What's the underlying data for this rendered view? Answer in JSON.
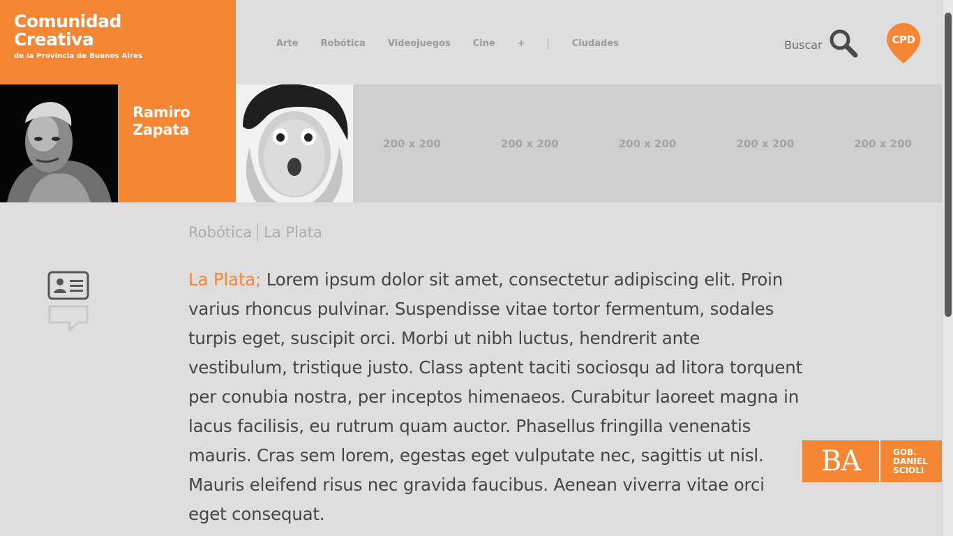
{
  "header": {
    "logo": {
      "line1": "Comunidad",
      "line2": "Creativa",
      "sub": "de la Provincia de Buenos Aires"
    },
    "nav": [
      "Arte",
      "Robótica",
      "Videojuegos",
      "Cine",
      "+",
      "Ciudades"
    ],
    "search_label": "Buscar",
    "cpd_label": "CPD"
  },
  "gallery": {
    "person_name_line1": "Ramiro",
    "person_name_line2": "Zapata",
    "placeholders": [
      "200 x 200",
      "200 x 200",
      "200 x 200",
      "200 x 200",
      "200 x 200"
    ]
  },
  "content": {
    "breadcrumb": {
      "category": "Robótica",
      "city": "La Plata"
    },
    "article": {
      "lead": "La Plata;",
      "body": " Lorem ipsum dolor sit amet, consectetur adipiscing elit. Proin varius rhoncus pulvinar. Suspendisse vitae tortor fermentum, sodales turpis eget, suscipit orci. Morbi ut nibh luctus, hendrerit ante vestibulum, tristique justo. Class aptent taciti sociosqu ad litora torquent per conubia nostra, per inceptos himenaeos. Curabitur laoreet magna in lacus facilisis, eu rutrum quam auctor. Phasellus fringilla venenatis mauris. Cras sem lorem, egestas eget vulputate nec, sagittis ut nisl. Mauris eleifend risus nec gravida faucibus. Aenean viverra vitae orci eget consequat."
    }
  },
  "footer_badge": {
    "ba": "BA",
    "gov_line1": "GOB.",
    "gov_line2": "DANIEL",
    "gov_line3": "SCIOLI"
  },
  "colors": {
    "accent": "#f58634",
    "background": "#dedede",
    "nav_text": "#9a9a9a",
    "body_text": "#454545"
  },
  "icons": [
    "search-icon",
    "cpd-pin-icon",
    "id-card-icon",
    "comment-icon"
  ]
}
